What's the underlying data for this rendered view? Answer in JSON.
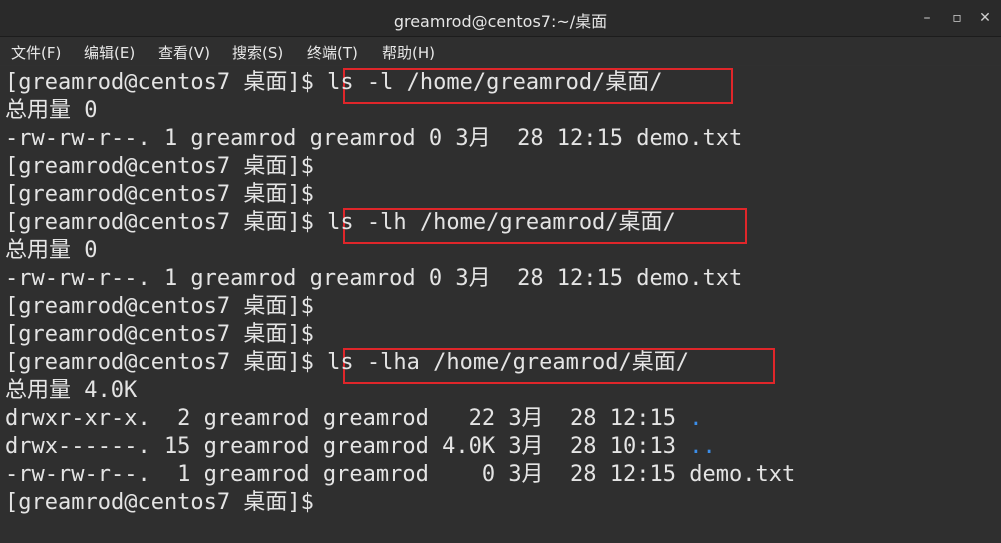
{
  "window": {
    "title": "greamrod@centos7:~/桌面",
    "controls": {
      "minimize": "–",
      "maximize": "▫",
      "close": "✕"
    }
  },
  "menu": {
    "items": [
      "文件(F)",
      "编辑(E)",
      "查看(V)",
      "搜索(S)",
      "终端(T)",
      "帮助(H)"
    ]
  },
  "terminal": {
    "prompt": "[greamrod@centos7 桌面]$ ",
    "lines": [
      {
        "type": "prompt",
        "cmd": "ls -l /home/greamrod/桌面/",
        "boxed": true
      },
      {
        "type": "out",
        "text": "总用量 0"
      },
      {
        "type": "out",
        "text": "-rw-rw-r--. 1 greamrod greamrod 0 3月  28 12:15 demo.txt"
      },
      {
        "type": "prompt",
        "cmd": ""
      },
      {
        "type": "prompt",
        "cmd": ""
      },
      {
        "type": "prompt",
        "cmd": "ls -lh /home/greamrod/桌面/",
        "boxed": true
      },
      {
        "type": "out",
        "text": "总用量 0"
      },
      {
        "type": "out",
        "text": "-rw-rw-r--. 1 greamrod greamrod 0 3月  28 12:15 demo.txt"
      },
      {
        "type": "prompt",
        "cmd": ""
      },
      {
        "type": "prompt",
        "cmd": ""
      },
      {
        "type": "prompt",
        "cmd": "ls -lha /home/greamrod/桌面/",
        "boxed": true
      },
      {
        "type": "out",
        "text": "总用量 4.0K"
      },
      {
        "type": "out",
        "text": "drwxr-xr-x.  2 greamrod greamrod   22 3月  28 12:15 ",
        "suffix": "."
      },
      {
        "type": "out",
        "text": "drwx------. 15 greamrod greamrod 4.0K 3月  28 10:13 ",
        "suffix": ".."
      },
      {
        "type": "out",
        "text": "-rw-rw-r--.  1 greamrod greamrod    0 3月  28 12:15 demo.txt"
      },
      {
        "type": "prompt",
        "cmd": ""
      }
    ]
  },
  "colors": {
    "background": "#2f2f2f",
    "text": "#e4e4e4",
    "highlight_box": "#e0262a",
    "dir_link": "#3b8eea"
  }
}
